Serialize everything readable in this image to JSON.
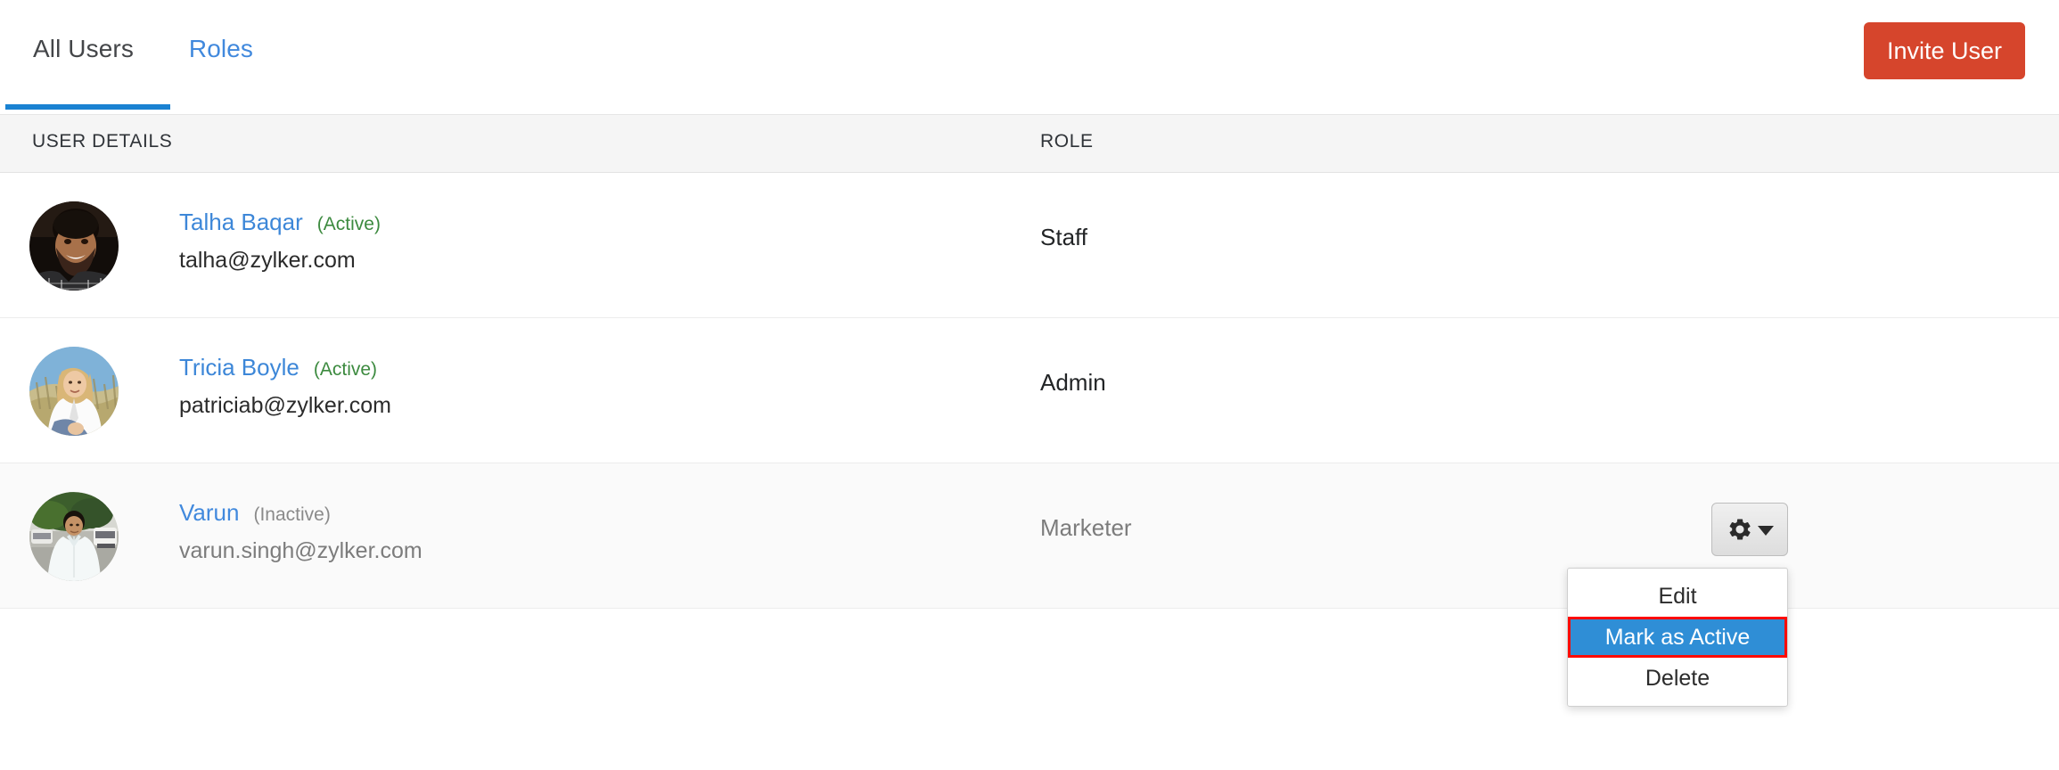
{
  "header": {
    "tabs": [
      {
        "label": "All Users",
        "active": true
      },
      {
        "label": "Roles",
        "active": false
      }
    ],
    "invite_button": "Invite User",
    "accent_color": "#d6452c",
    "active_tab_underline_color": "#1a82d2"
  },
  "table": {
    "columns": [
      {
        "key": "user_details",
        "label": "USER DETAILS"
      },
      {
        "key": "role",
        "label": "ROLE"
      }
    ],
    "rows": [
      {
        "name": "Talha Baqar",
        "status": "(Active)",
        "status_state": "active",
        "email": "talha@zylker.com",
        "role": "Staff",
        "avatar": "photo-male-beard",
        "row_state": "normal"
      },
      {
        "name": "Tricia Boyle",
        "status": "(Active)",
        "status_state": "active",
        "email": "patriciab@zylker.com",
        "role": "Admin",
        "avatar": "photo-female-blonde",
        "row_state": "normal"
      },
      {
        "name": "Varun",
        "status": "(Inactive)",
        "status_state": "inactive",
        "email": "varun.singh@zylker.com",
        "role": "Marketer",
        "avatar": "photo-male-white-shirt",
        "row_state": "hovered"
      }
    ]
  },
  "row_actions": {
    "trigger_icon": "gear-icon",
    "trigger_caret": "chevron-down-icon",
    "menu": [
      {
        "label": "Edit",
        "selected": false
      },
      {
        "label": "Mark as Active",
        "selected": true
      },
      {
        "label": "Delete",
        "selected": false
      }
    ],
    "selected_background": "#2f8ed6",
    "selection_outline_color": "#ff0b00"
  },
  "colors": {
    "link_blue": "#3d87d8",
    "status_green": "#3c8a3f",
    "status_grey": "#8a8a8a",
    "header_background": "#f5f5f5",
    "row_hover_background": "#fafafa"
  }
}
